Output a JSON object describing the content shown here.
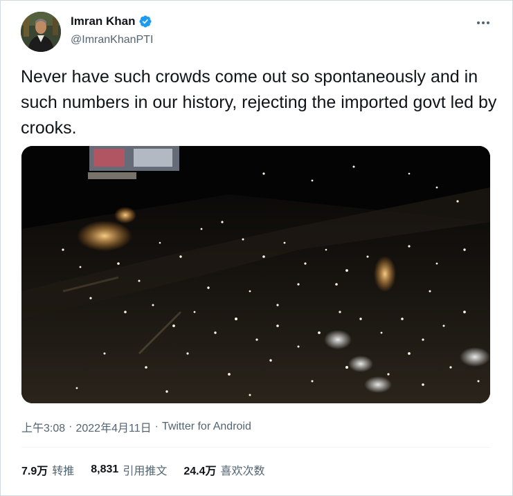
{
  "author": {
    "name": "Imran Khan",
    "handle": "@ImranKhanPTI",
    "verified": true,
    "verified_color": "#1d9bf0"
  },
  "tweet": {
    "text": "Never have such crowds come out so spontaneously and in such numbers in our history, rejecting the imported govt led by crooks.",
    "media_type": "video",
    "media_icon": "night-crowd-video"
  },
  "meta": {
    "time": "上午3:08",
    "separator": "·",
    "date": "2022年4月11日",
    "source": "Twitter for Android"
  },
  "stats": {
    "retweets_count": "7.9万",
    "retweets_label": "转推",
    "quotes_count": "8,831",
    "quotes_label": "引用推文",
    "likes_count": "24.4万",
    "likes_label": "喜欢次数"
  },
  "icons": {
    "more": "more-horizontal-icon",
    "verified": "verified-badge-icon"
  }
}
